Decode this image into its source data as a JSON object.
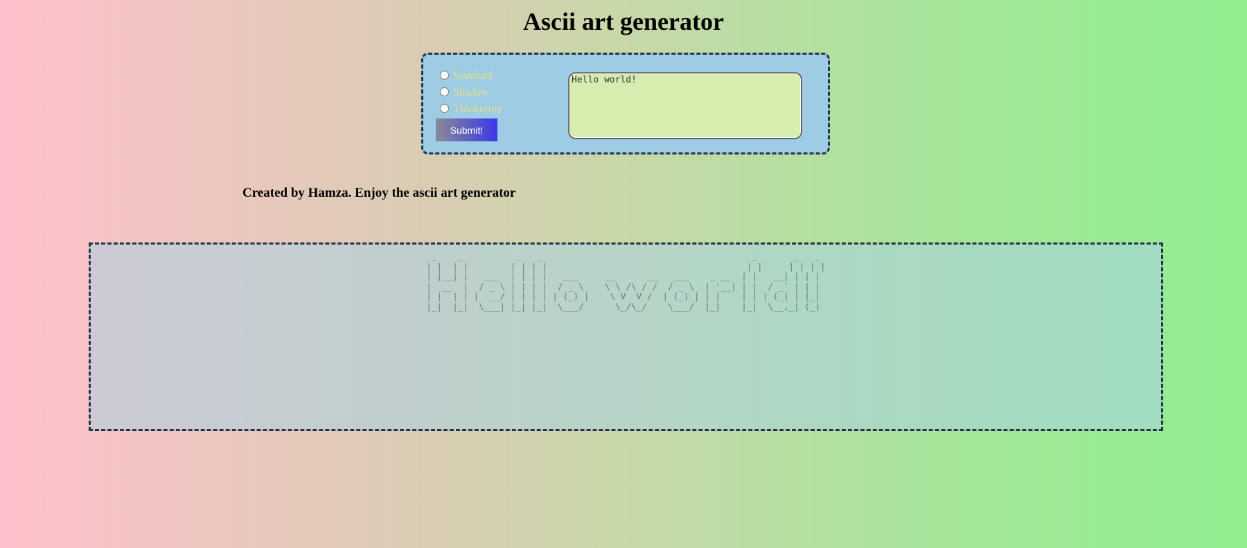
{
  "page": {
    "title": "Ascii art generator"
  },
  "form": {
    "options": [
      {
        "label": "Standard",
        "value": "standard"
      },
      {
        "label": "Shadow",
        "value": "shadow"
      },
      {
        "label": "Thinkertoy",
        "value": "thinkertoy"
      }
    ],
    "input_value": "Hello world!",
    "submit_label": "Submit!"
  },
  "credit": "Created by Hamza. Enjoy the ascii art generator",
  "output": {
    "ascii": " _    _          _   _                                        _       _   _ \n| |  | |        | | | |                                      | |     | | | |\n| |__| |   ___  | | | |   ___     __      __   ___    _ __  | |   __| | | |\n|  __  |  / _ \\ | | | |  / _ \\    \\ \\ /\\ / /  / _ \\  | '__| | |  / _` | | |\n| |  | | |  __/ | | | | | (_) |    \\ V  V /  | (_) | | |    | | | (_| | |_|\n|_|  |_|  \\___| |_| |_|  \\___/      \\_/\\_/    \\___/  |_|    |_|  \\__,_| (_)"
  },
  "colors": {
    "gradient_start": "#ffc0cb",
    "gradient_end": "#90ee90",
    "panel_bg": "#9dcce4",
    "radio_label": "#e8e08a",
    "textarea_bg": "#d6edb0"
  }
}
